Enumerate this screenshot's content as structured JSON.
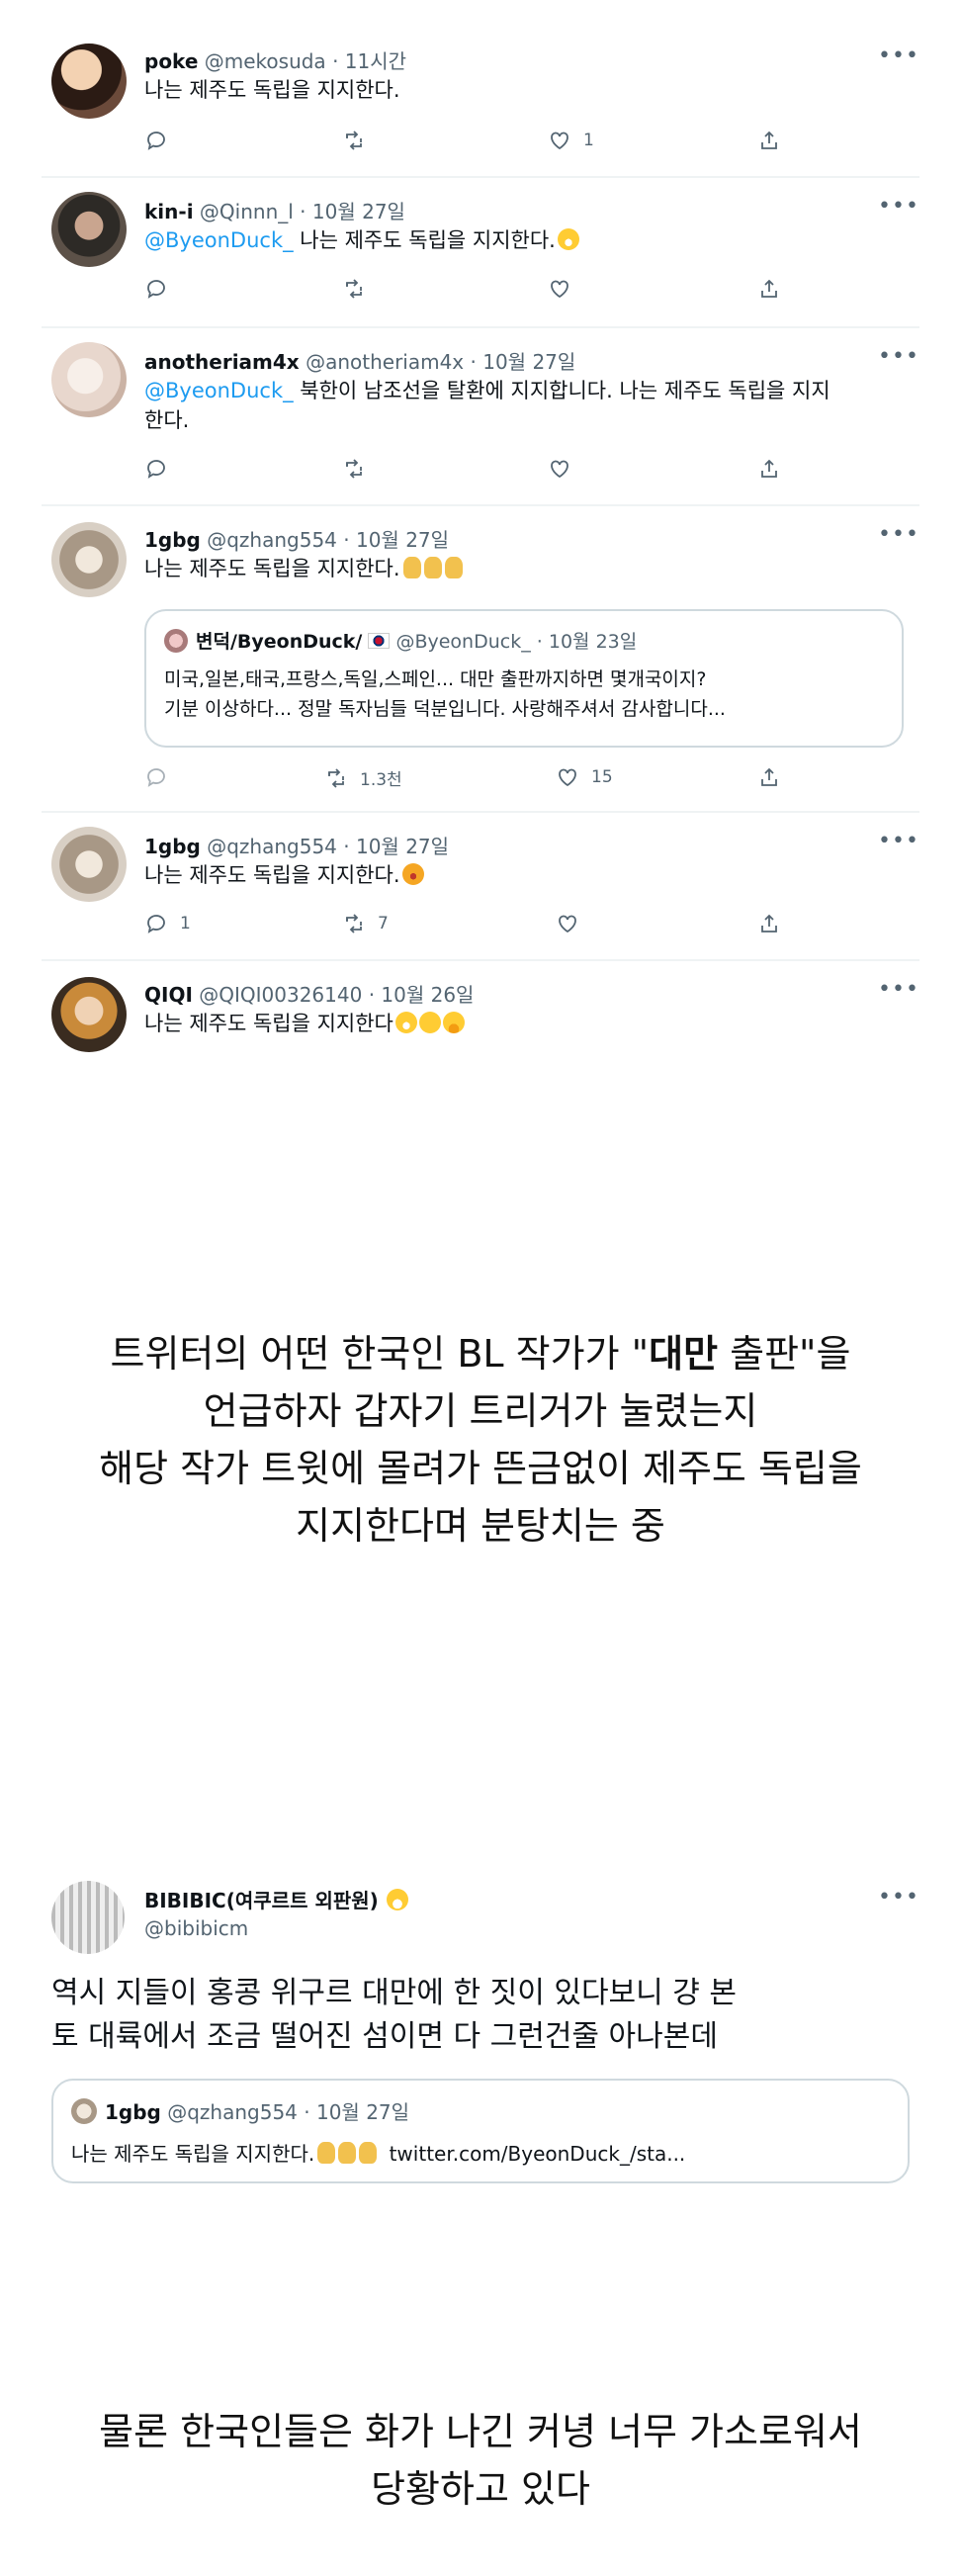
{
  "tweets": [
    {
      "name": "poke",
      "handle": "@mekosuda",
      "time": "11시간",
      "text": "나는 제주도 독립을 지지한다.",
      "reply": "",
      "retweet": "",
      "like": "1"
    },
    {
      "name": "kin-i",
      "handle": "@Qinnn_l",
      "time": "10월 27일",
      "mention": "@ByeonDuck_",
      "text": "나는 제주도 독립을 지지한다.",
      "reply": "",
      "retweet": "",
      "like": ""
    },
    {
      "name": "anotheriam4x",
      "handle": "@anotheriam4x",
      "time": "10월 27일",
      "mention": "@ByeonDuck_",
      "text_a": "북한이 남조선을 탈환에 지지합니다. 나는 제주도 독립을 지지",
      "text_b": "한다.",
      "reply": "",
      "retweet": "",
      "like": ""
    },
    {
      "name": "1gbg",
      "handle": "@qzhang554",
      "time": "10월 27일",
      "text": "나는 제주도 독립을 지지한다.",
      "quote": {
        "name": "변덕/ByeonDuck/",
        "handle": "@ByeonDuck_",
        "time": "10월 23일",
        "line1": "미국,일본,태국,프랑스,독일,스페인... 대만 출판까지하면 몇개국이지?",
        "line2": "기분 이상하다... 정말 독자님들 덕분입니다. 사랑해주셔서 감사합니다..."
      },
      "reply": "",
      "retweet": "1.3천",
      "like": "15"
    },
    {
      "name": "1gbg",
      "handle": "@qzhang554",
      "time": "10월 27일",
      "text": "나는 제주도 독립을 지지한다.",
      "reply": "1",
      "retweet": "7",
      "like": ""
    },
    {
      "name": "QIQI",
      "handle": "@QIQI00326140",
      "time": "10월 26일",
      "text": "나는 제주도 독립을 지지한다",
      "reply": "",
      "retweet": "",
      "like": ""
    }
  ],
  "dot_sep": "·",
  "more_label": "•••",
  "caption1": {
    "line1_a": "트위터의 어떤 한국인 BL 작가가 \"",
    "line1_bold": "대만",
    "line1_b": " 출판\"을",
    "line2": "언급하자 갑자기 트리거가 눌렸는지",
    "line3": "해당 작가 트윗에 몰려가 뜬금없이 제주도 독립을",
    "line4": "지지한다며 분탕치는 중"
  },
  "bibi": {
    "name": "BIBIBIC(여쿠르트 외판원)",
    "handle": "@bibibicm",
    "text_line1": "역시 지들이 홍콩 위구르 대만에 한 짓이 있다보니 걍 본",
    "text_line2": "토 대륙에서 조금 떨어진 섬이면 다 그런건줄 아나본데",
    "quote": {
      "name": "1gbg",
      "handle": "@qzhang554",
      "time": "10월 27일",
      "text": "나는 제주도 독립을 지지한다.",
      "link": "twitter.com/ByeonDuck_/sta..."
    }
  },
  "caption2": {
    "line1": "물론 한국인들은 화가 나긴 커녕 너무 가소로워서",
    "line2": "당황하고 있다"
  },
  "colors": {
    "accent": "#1d9bf0",
    "muted": "#536471",
    "text": "#0f1419",
    "border": "#cfd9de"
  }
}
